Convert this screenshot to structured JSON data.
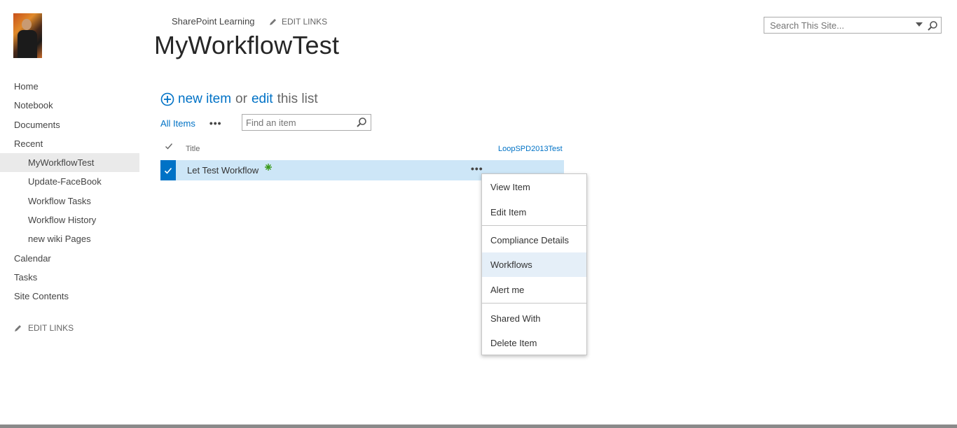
{
  "header": {
    "site_title": "SharePoint Learning",
    "edit_links": "EDIT LINKS",
    "page_title": "MyWorkflowTest"
  },
  "search": {
    "placeholder": "Search This Site..."
  },
  "leftnav": {
    "items": [
      {
        "label": "Home"
      },
      {
        "label": "Notebook"
      },
      {
        "label": "Documents"
      },
      {
        "label": "Recent"
      },
      {
        "label": "MyWorkflowTest"
      },
      {
        "label": "Update-FaceBook"
      },
      {
        "label": "Workflow Tasks"
      },
      {
        "label": "Workflow History"
      },
      {
        "label": "new wiki Pages"
      },
      {
        "label": "Calendar"
      },
      {
        "label": "Tasks"
      },
      {
        "label": "Site Contents"
      }
    ],
    "edit_links": "EDIT LINKS"
  },
  "toolbar": {
    "new_item": "new item",
    "or": "or",
    "edit": "edit",
    "this_list": "this list",
    "all_items": "All Items",
    "more": "•••",
    "find_placeholder": "Find an item"
  },
  "list": {
    "columns": {
      "title": "Title",
      "workflow_col": "LoopSPD2013Test"
    },
    "rows": [
      {
        "title": "Let Test Workflow",
        "dots": "•••"
      }
    ]
  },
  "context_menu": {
    "items": [
      {
        "label": "View Item"
      },
      {
        "label": "Edit Item"
      },
      {
        "label": "Compliance Details"
      },
      {
        "label": "Workflows"
      },
      {
        "label": "Alert me"
      },
      {
        "label": "Shared With"
      },
      {
        "label": "Delete Item"
      }
    ]
  },
  "colors": {
    "accent": "#0072c6",
    "row_selected": "#cde6f7",
    "menu_hover": "#e5eff8"
  }
}
